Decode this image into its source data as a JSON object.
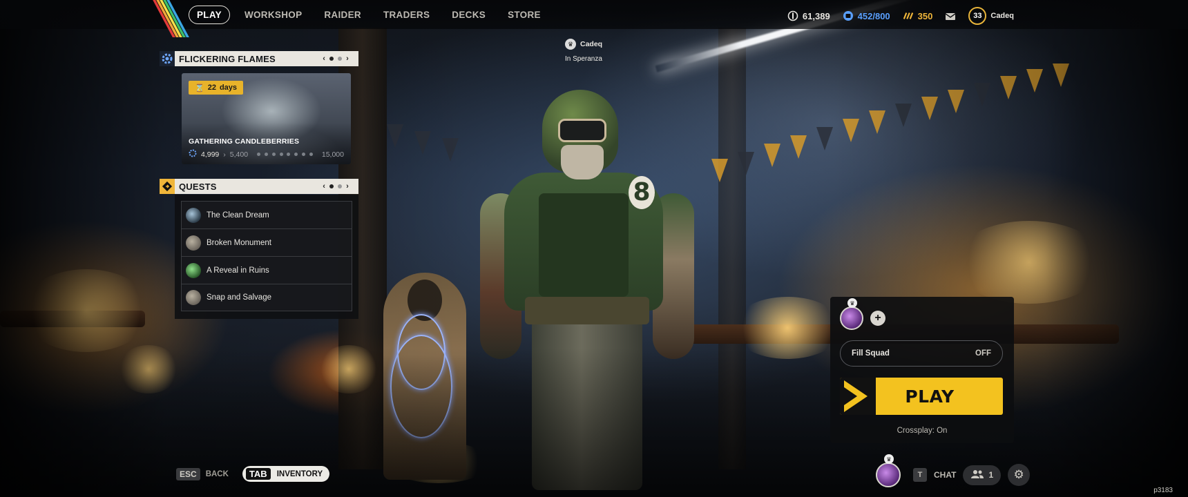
{
  "nav": {
    "items": [
      {
        "label": "PLAY",
        "active": true
      },
      {
        "label": "WORKSHOP",
        "active": false
      },
      {
        "label": "RAIDER",
        "active": false
      },
      {
        "label": "TRADERS",
        "active": false
      },
      {
        "label": "DECKS",
        "active": false
      },
      {
        "label": "STORE",
        "active": false
      }
    ]
  },
  "currencies": {
    "coins": {
      "value": "61,389",
      "icon": "coin-icon"
    },
    "capacity": {
      "value": "452/800",
      "icon": "stash-icon",
      "color": "#5aa0ff"
    },
    "tokens": {
      "value": "350",
      "icon": "token-icon",
      "color": "#f0b63a"
    },
    "mail_icon": "mail-icon"
  },
  "profile": {
    "level": "33",
    "username": "Cadeq"
  },
  "player_tag": {
    "name": "Cadeq",
    "location": "In Speranza"
  },
  "event_panel": {
    "title": "FLICKERING FLAMES",
    "timer_value": "22",
    "timer_unit": "days",
    "card_title": "GATHERING CANDLEBERRIES",
    "progress_current": "4,999",
    "progress_next": "5,400",
    "progress_max": "15,000"
  },
  "quests_panel": {
    "title": "QUESTS",
    "items": [
      {
        "name": "The Clean Dream"
      },
      {
        "name": "Broken Monument"
      },
      {
        "name": "A Reveal in Ruins"
      },
      {
        "name": "Snap and Salvage"
      }
    ]
  },
  "squad": {
    "fill_squad_label": "Fill Squad",
    "fill_squad_value": "OFF",
    "play_label": "PLAY",
    "crossplay": "Crossplay: On"
  },
  "bottom": {
    "esc_key": "ESC",
    "back_label": "BACK",
    "tab_key": "TAB",
    "inventory_label": "INVENTORY",
    "chat_key": "T",
    "chat_label": "CHAT",
    "friends_count": "1"
  },
  "build_id": "p3183",
  "colors": {
    "accent": "#f3c21f",
    "panel_header": "#e9e6df"
  }
}
